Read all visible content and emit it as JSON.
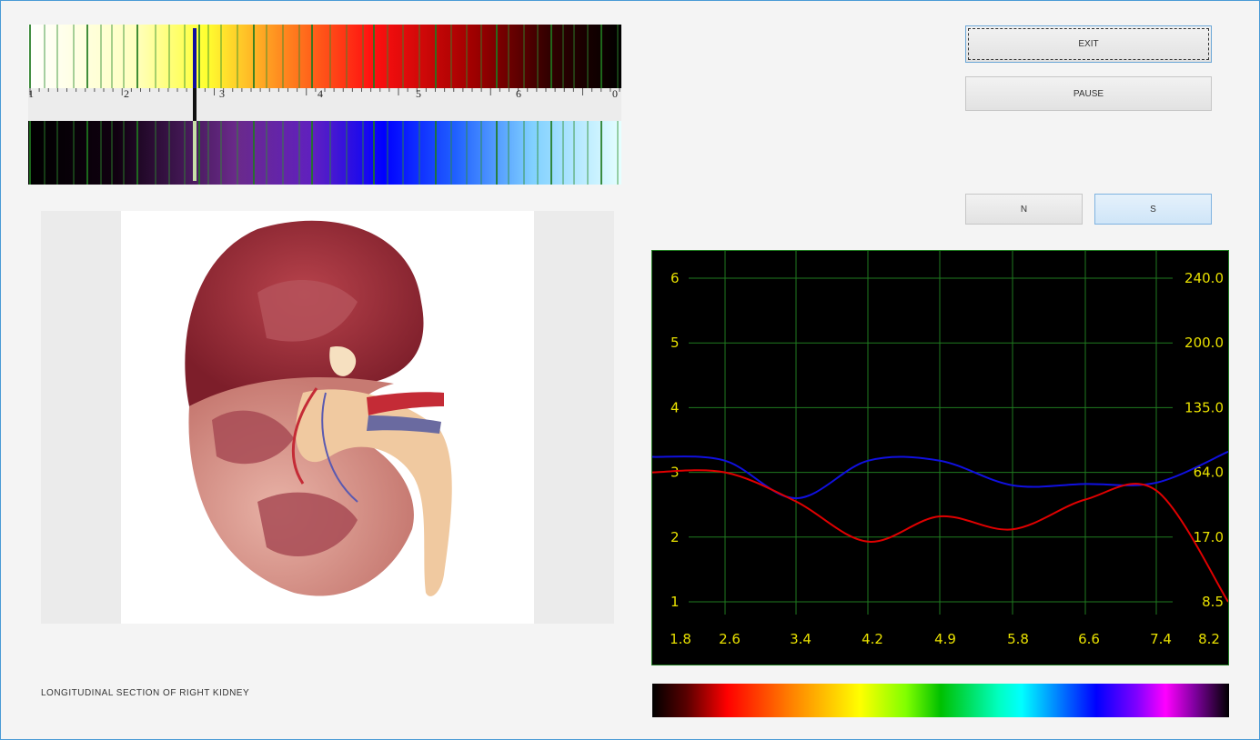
{
  "buttons": {
    "exit": "EXIT",
    "pause": "PAUSE",
    "n": "N",
    "s": "S"
  },
  "caption": "LONGITUDINAL SECTION OF RIGHT KIDNEY",
  "spectrum": {
    "ruler_labels": [
      "1",
      "2",
      "3",
      "4",
      "5",
      "6",
      "0"
    ],
    "marker_position": 0.28,
    "marker_icon": "marker-needle-icon"
  },
  "image": {
    "subject_icon": "kidney-section-illustration"
  },
  "colors": {
    "accent": "#4a9bd6",
    "chart_grid": "#1f7a1f",
    "chart_text": "#e8e000",
    "series_blue": "#1010e0",
    "series_red": "#e00000"
  },
  "chart_data": {
    "type": "line",
    "x_tick_labels": [
      "1.8",
      "2.6",
      "3.4",
      "4.2",
      "4.9",
      "5.8",
      "6.6",
      "7.4",
      "8.2"
    ],
    "y_left_ticks": [
      "6",
      "5",
      "4",
      "3",
      "2",
      "1"
    ],
    "y_right_ticks": [
      "240.0",
      "200.0",
      "135.0",
      "64.0",
      "17.0",
      "8.5"
    ],
    "ylim": [
      0.5,
      6.5
    ],
    "xlim": [
      1.8,
      8.2
    ],
    "grid": true,
    "series": [
      {
        "color": "#1010e0",
        "x": [
          1.8,
          2.6,
          3.4,
          4.2,
          4.9,
          5.8,
          6.6,
          7.4,
          8.2
        ],
        "values": [
          3.24,
          3.18,
          2.6,
          3.18,
          3.18,
          2.8,
          2.82,
          2.84,
          3.32
        ]
      },
      {
        "color": "#e00000",
        "x": [
          1.8,
          2.6,
          3.4,
          4.2,
          4.9,
          5.8,
          6.6,
          7.4,
          8.2
        ],
        "values": [
          3.0,
          3.0,
          2.55,
          1.93,
          2.32,
          2.12,
          2.58,
          2.72,
          1.0
        ]
      }
    ]
  }
}
